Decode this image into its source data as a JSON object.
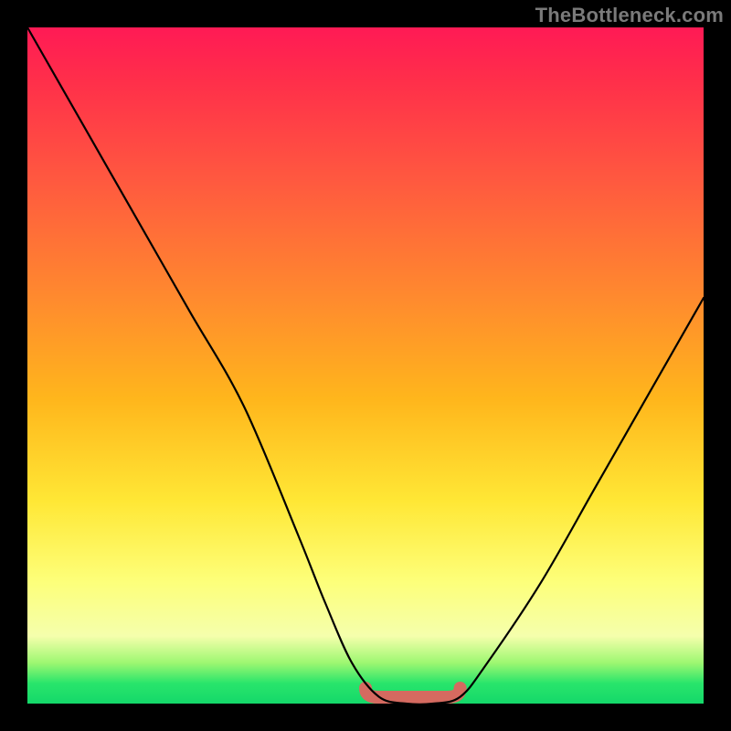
{
  "watermark": "TheBottleneck.com",
  "chart_data": {
    "type": "line",
    "title": "",
    "xlabel": "",
    "ylabel": "",
    "xlim": [
      0,
      100
    ],
    "ylim": [
      0,
      100
    ],
    "grid": false,
    "legend": false,
    "series": [
      {
        "name": "bottleneck-curve",
        "x": [
          0,
          8,
          16,
          24,
          32,
          40,
          44,
          48,
          52,
          56,
          60,
          64,
          68,
          76,
          84,
          92,
          100
        ],
        "values": [
          100,
          86,
          72,
          58,
          44,
          25,
          15,
          6,
          1,
          0,
          0,
          1,
          6,
          18,
          32,
          46,
          60
        ]
      }
    ],
    "highlight": {
      "name": "optimal-basin",
      "x_start": 50,
      "x_end": 64,
      "y": 0
    },
    "background_gradient": {
      "stops": [
        {
          "pos": 0.0,
          "color": "#ff1a55"
        },
        {
          "pos": 0.55,
          "color": "#ffb61c"
        },
        {
          "pos": 0.82,
          "color": "#fdff7a"
        },
        {
          "pos": 0.97,
          "color": "#29e56b"
        },
        {
          "pos": 1.0,
          "color": "#14d86a"
        }
      ]
    }
  }
}
